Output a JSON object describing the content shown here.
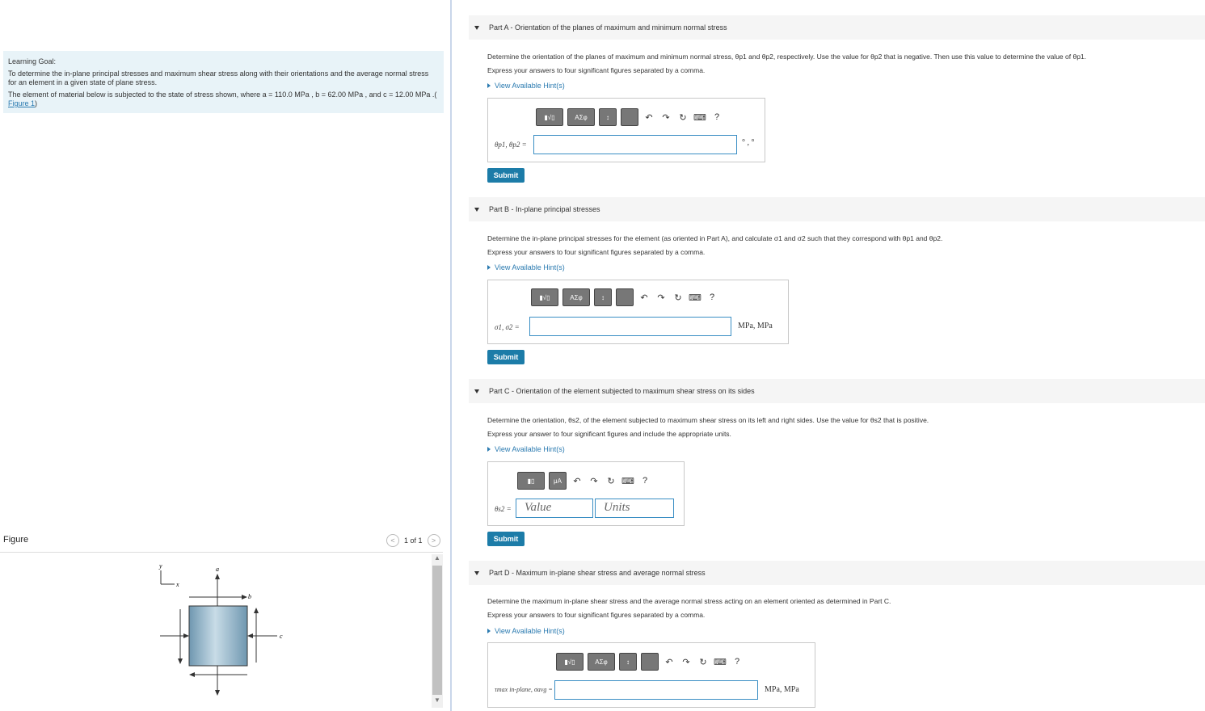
{
  "goal": {
    "title": "Learning Goal:",
    "text": "To determine the in-plane principal stresses and maximum shear stress along with their orientations and the average normal stress for an element in a given state of plane stress.",
    "element_text": "The element of material below is subjected to the state of stress shown, where a = 110.0 MPa , b = 62.00 MPa , and c = 12.00 MPa .(",
    "figure_link": "Figure 1",
    "close_paren": ")"
  },
  "figure": {
    "title": "Figure",
    "pager": "1 of 1",
    "prev_icon": "<",
    "next_icon": ">",
    "labels": {
      "y": "y",
      "x": "x",
      "a": "a",
      "b": "b",
      "c": "c"
    }
  },
  "parts": [
    {
      "title": "Part A - Orientation of the planes of maximum and minimum normal stress",
      "instruction": "Determine the orientation of the planes of maximum and minimum normal stress, θp1 and θp2, respectively. Use the value for θp2 that is negative. Then use this value to determine the value of θp1.",
      "express": "Express your answers to four significant figures separated by a comma.",
      "hint": "View Available Hint(s)",
      "label": "θp1, θp2 =",
      "units": "° , °",
      "submit": "Submit"
    },
    {
      "title": "Part B - In-plane principal stresses",
      "instruction": "Determine the in-plane principal stresses for the element (as oriented in Part A), and calculate σ1 and σ2 such that they correspond with θp1 and θp2.",
      "express": "Express your answers to four significant figures separated by a comma.",
      "hint": "View Available Hint(s)",
      "label": "σ1, σ2 =",
      "units": "MPa, MPa",
      "submit": "Submit"
    },
    {
      "title": "Part C - Orientation of the element subjected to maximum shear stress on its sides",
      "instruction": "Determine the orientation, θs2, of the element subjected to maximum shear stress on its left and right sides. Use the value for θs2 that is positive.",
      "express": "Express your answer to four significant figures and include the appropriate units.",
      "hint": "View Available Hint(s)",
      "label": "θs2 =",
      "value_placeholder": "Value",
      "units_placeholder": "Units",
      "submit": "Submit"
    },
    {
      "title": "Part D - Maximum in-plane shear stress and average normal stress",
      "instruction": "Determine the maximum in-plane shear stress and the average normal stress acting on an element oriented as determined in Part C.",
      "express": "Express your answers to four significant figures separated by a comma.",
      "hint": "View Available Hint(s)",
      "label": "τmax in-plane, σavg =",
      "units": "MPa, MPa"
    }
  ],
  "toolbar": {
    "template_btn": "▮√▯",
    "greek_btn": "ΑΣφ",
    "vec_btn": "↕",
    "units_btn": "μA",
    "undo": "↶",
    "redo": "↷",
    "reset": "↻",
    "keyboard": "⌨",
    "help": "?"
  },
  "colors": {
    "accent": "#1c7ca8",
    "goal_bg": "#e8f3f8",
    "element_fill": "#8fb3c8"
  }
}
